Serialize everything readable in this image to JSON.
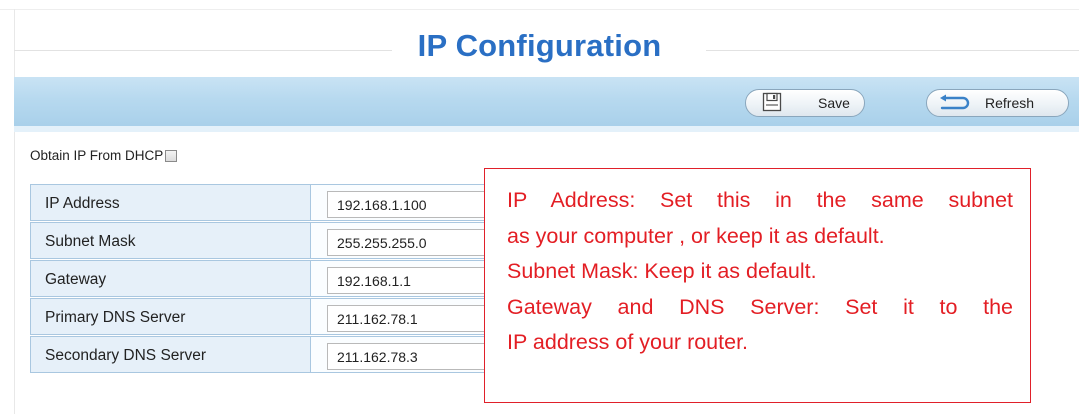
{
  "page": {
    "title": "IP Configuration"
  },
  "toolbar": {
    "save_label": "Save",
    "refresh_label": "Refresh"
  },
  "dhcp": {
    "label": "Obtain IP From DHCP",
    "checked": false
  },
  "fields": [
    {
      "label": "IP Address",
      "value": "192.168.1.100"
    },
    {
      "label": "Subnet Mask",
      "value": "255.255.255.0"
    },
    {
      "label": "Gateway",
      "value": "192.168.1.1"
    },
    {
      "label": "Primary DNS Server",
      "value": "211.162.78.1"
    },
    {
      "label": "Secondary DNS Server",
      "value": "211.162.78.3"
    }
  ],
  "annotation": {
    "lines": [
      "IP Address: Set this in the same subnet",
      "as your computer , or keep it as default.",
      "Subnet Mask: Keep it as default.",
      "Gateway and DNS Server: Set it to the",
      "IP address of your router."
    ],
    "color": "#e31e24"
  },
  "colors": {
    "title": "#2a6fc4",
    "toolbar": "#b7d9ef",
    "label_cell": "#e6f0f9",
    "grid_border": "#a9c7e0"
  },
  "icons": {
    "save": "floppy-disk-icon",
    "refresh": "refresh-arrow-icon"
  }
}
